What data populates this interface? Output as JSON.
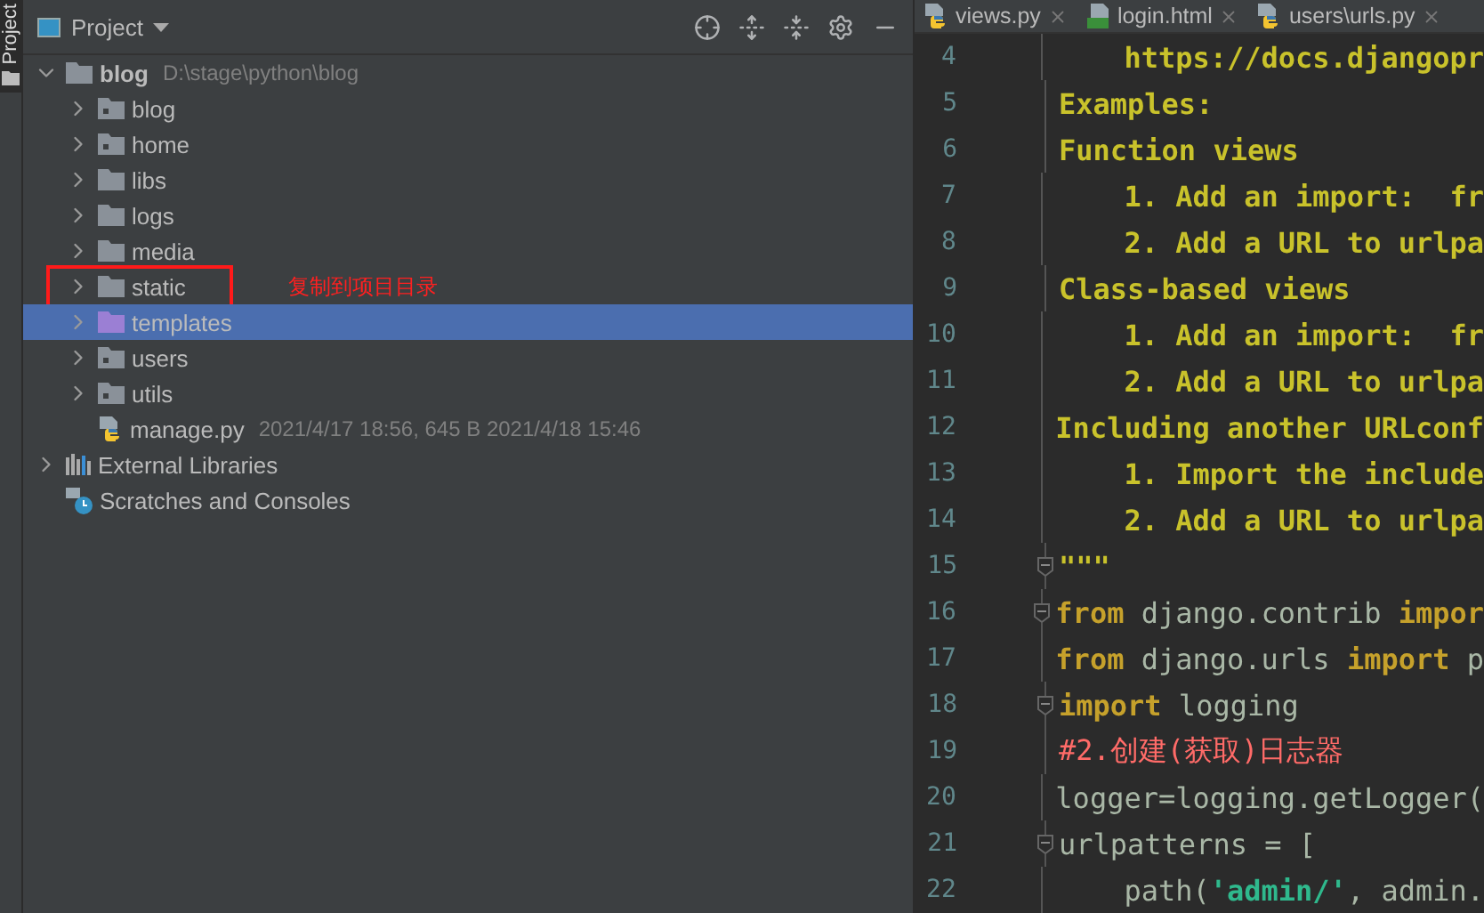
{
  "side_tab": {
    "label": "Project"
  },
  "project_panel": {
    "title": "Project",
    "tree": [
      {
        "label": "blog",
        "path": "D:\\stage\\python\\blog",
        "kind": "folder",
        "expanded": true,
        "selected": false,
        "children": [
          {
            "label": "blog",
            "kind": "module",
            "expanded": false,
            "selected": false
          },
          {
            "label": "home",
            "kind": "module",
            "expanded": false,
            "selected": false
          },
          {
            "label": "libs",
            "kind": "folder",
            "expanded": false,
            "selected": false
          },
          {
            "label": "logs",
            "kind": "folder",
            "expanded": false,
            "selected": false
          },
          {
            "label": "media",
            "kind": "folder",
            "expanded": false,
            "selected": false
          },
          {
            "label": "static",
            "kind": "folder",
            "expanded": false,
            "selected": false,
            "annotation": "复制到项目目录"
          },
          {
            "label": "templates",
            "kind": "templates",
            "expanded": false,
            "selected": true
          },
          {
            "label": "users",
            "kind": "module",
            "expanded": false,
            "selected": false
          },
          {
            "label": "utils",
            "kind": "module",
            "expanded": false,
            "selected": false
          },
          {
            "label": "manage.py",
            "kind": "python",
            "selected": false,
            "meta": "2021/4/17 18:56, 645 B 2021/4/18 15:46"
          }
        ]
      },
      {
        "label": "External Libraries",
        "kind": "libraries",
        "expanded": false,
        "selected": false
      },
      {
        "label": "Scratches and Consoles",
        "kind": "scratches",
        "selected": false
      }
    ]
  },
  "editor": {
    "tabs": [
      {
        "label": "views.py",
        "kind": "python"
      },
      {
        "label": "login.html",
        "kind": "html"
      },
      {
        "label": "users\\urls.py",
        "kind": "python"
      }
    ],
    "lines": [
      {
        "number": "4",
        "tokens": [
          {
            "text": "    https://docs.djangopr",
            "kind": "doc"
          }
        ]
      },
      {
        "number": "5",
        "tokens": [
          {
            "text": "Examples:",
            "kind": "doc"
          }
        ]
      },
      {
        "number": "6",
        "tokens": [
          {
            "text": "Function views",
            "kind": "doc"
          }
        ]
      },
      {
        "number": "7",
        "tokens": [
          {
            "text": "    1. Add an import:  fr",
            "kind": "doc"
          }
        ]
      },
      {
        "number": "8",
        "tokens": [
          {
            "text": "    2. Add a URL to urlpa",
            "kind": "doc"
          }
        ]
      },
      {
        "number": "9",
        "tokens": [
          {
            "text": "Class-based views",
            "kind": "doc"
          }
        ]
      },
      {
        "number": "10",
        "tokens": [
          {
            "text": "    1. Add an import:  fr",
            "kind": "doc"
          }
        ]
      },
      {
        "number": "11",
        "tokens": [
          {
            "text": "    2. Add a URL to urlpa",
            "kind": "doc"
          }
        ]
      },
      {
        "number": "12",
        "tokens": [
          {
            "text": "Including another URLconf",
            "kind": "doc"
          }
        ]
      },
      {
        "number": "13",
        "tokens": [
          {
            "text": "    1. Import the include",
            "kind": "doc"
          }
        ]
      },
      {
        "number": "14",
        "tokens": [
          {
            "text": "    2. Add a URL to urlpa",
            "kind": "doc"
          }
        ]
      },
      {
        "number": "15",
        "fold": true,
        "tokens": [
          {
            "text": "\"\"\"",
            "kind": "doc"
          }
        ]
      },
      {
        "number": "16",
        "fold": true,
        "tokens": [
          {
            "text": "from",
            "kind": "keyword"
          },
          {
            "text": " django.contrib ",
            "kind": "plain"
          },
          {
            "text": "impor",
            "kind": "keyword"
          }
        ]
      },
      {
        "number": "17",
        "tokens": [
          {
            "text": "from",
            "kind": "keyword"
          },
          {
            "text": " django.urls ",
            "kind": "plain"
          },
          {
            "text": "import",
            "kind": "keyword"
          },
          {
            "text": " p",
            "kind": "plain"
          }
        ]
      },
      {
        "number": "18",
        "fold": true,
        "tokens": [
          {
            "text": "import",
            "kind": "keyword"
          },
          {
            "text": " logging",
            "kind": "plain"
          }
        ]
      },
      {
        "number": "19",
        "tokens": [
          {
            "text": "#2.创建(获取)日志器",
            "kind": "comment"
          }
        ]
      },
      {
        "number": "20",
        "tokens": [
          {
            "text": "logger=logging.getLogger(",
            "kind": "plain"
          }
        ]
      },
      {
        "number": "21",
        "fold": true,
        "tokens": [
          {
            "text": "urlpatterns = [",
            "kind": "plain"
          }
        ]
      },
      {
        "number": "22",
        "tokens": [
          {
            "text": "    path(",
            "kind": "plain"
          },
          {
            "text": "'admin/'",
            "kind": "string"
          },
          {
            "text": ", admin.",
            "kind": "plain"
          }
        ]
      }
    ]
  }
}
